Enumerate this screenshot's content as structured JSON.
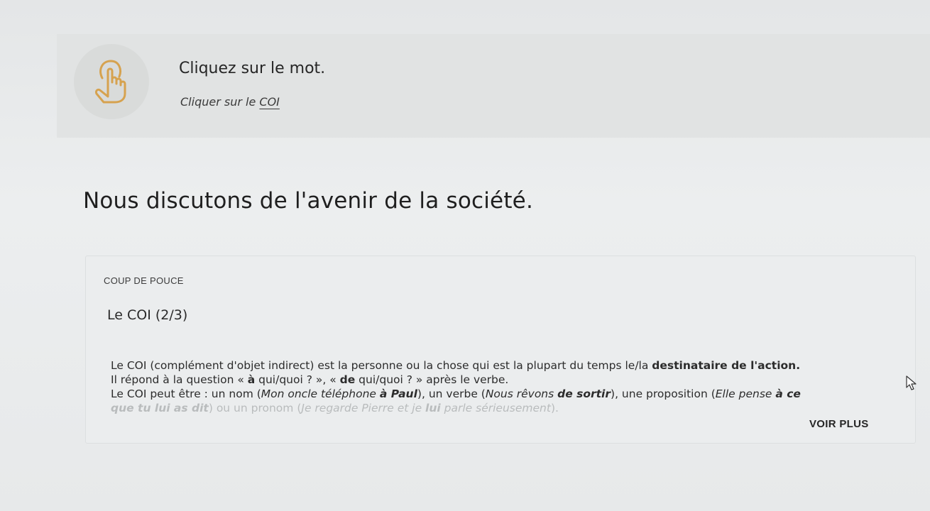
{
  "instruction": {
    "icon": "hand-pointer-icon",
    "title": "Cliquez sur le mot.",
    "subtitle_prefix": "Cliquer sur le",
    "subtitle_target": "COI"
  },
  "exercise": {
    "words": [
      "Nous",
      "discutons",
      "de",
      "l'avenir",
      "de",
      "la",
      "société."
    ]
  },
  "hint": {
    "label": "COUP DE POUCE",
    "title": "Le COI (2/3)",
    "line1": {
      "a": "Le COI (complément d'objet indirect) est la personne ou la chose qui est la plupart du temps le/la ",
      "b": "destinataire de l'action."
    },
    "line2": {
      "a": "Il répond à la question « ",
      "b": "à",
      "c": " qui/quoi ? », « ",
      "d": "de",
      "e": " qui/quoi ? » après le verbe."
    },
    "line3": {
      "a": "Le COI peut être : un nom (",
      "b": "Mon oncle téléphone ",
      "c": "à Paul",
      "d": "), un verbe (",
      "e": "Nous rêvons ",
      "f": "de sortir",
      "g": "), une proposition (",
      "h": "Elle pense ",
      "i": "à ce"
    },
    "line4": {
      "a": "que tu lui as dit",
      "b": ") ou un pronom (",
      "c": "Je regarde Pierre et je ",
      "d": "lui",
      "e": " parle sérieusement",
      "f": ")."
    },
    "see_more": "VOIR PLUS"
  }
}
